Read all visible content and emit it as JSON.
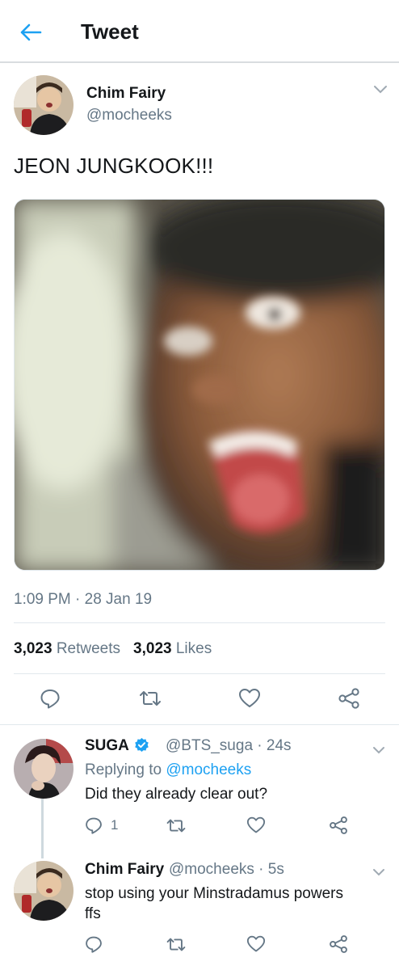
{
  "header": {
    "title": "Tweet",
    "back_icon": "arrow-left-icon"
  },
  "tweet": {
    "author_name": "Chim Fairy",
    "author_handle": "@mocheeks",
    "text": "JEON JUNGKOOK!!!",
    "timestamp": "1:09 PM · 28 Jan 19",
    "retweets_count": "3,023",
    "retweets_label": "Retweets",
    "likes_count": "3,023",
    "likes_label": "Likes"
  },
  "replies": [
    {
      "name": "SUGA",
      "verified": true,
      "handle_time": "@BTS_suga · 24s",
      "replying_prefix": "Replying to",
      "replying_handle": "@mocheeks",
      "text": "Did they already clear out?",
      "reply_count": "1"
    },
    {
      "name": "Chim Fairy",
      "handle_time": "@mocheeks · 5s",
      "text_line1": "stop using your Minstradamus powers",
      "text_line2": "ffs"
    }
  ],
  "colors": {
    "accent": "#1da1f2",
    "secondary_text": "#657786",
    "divider": "#e1e8ed"
  }
}
